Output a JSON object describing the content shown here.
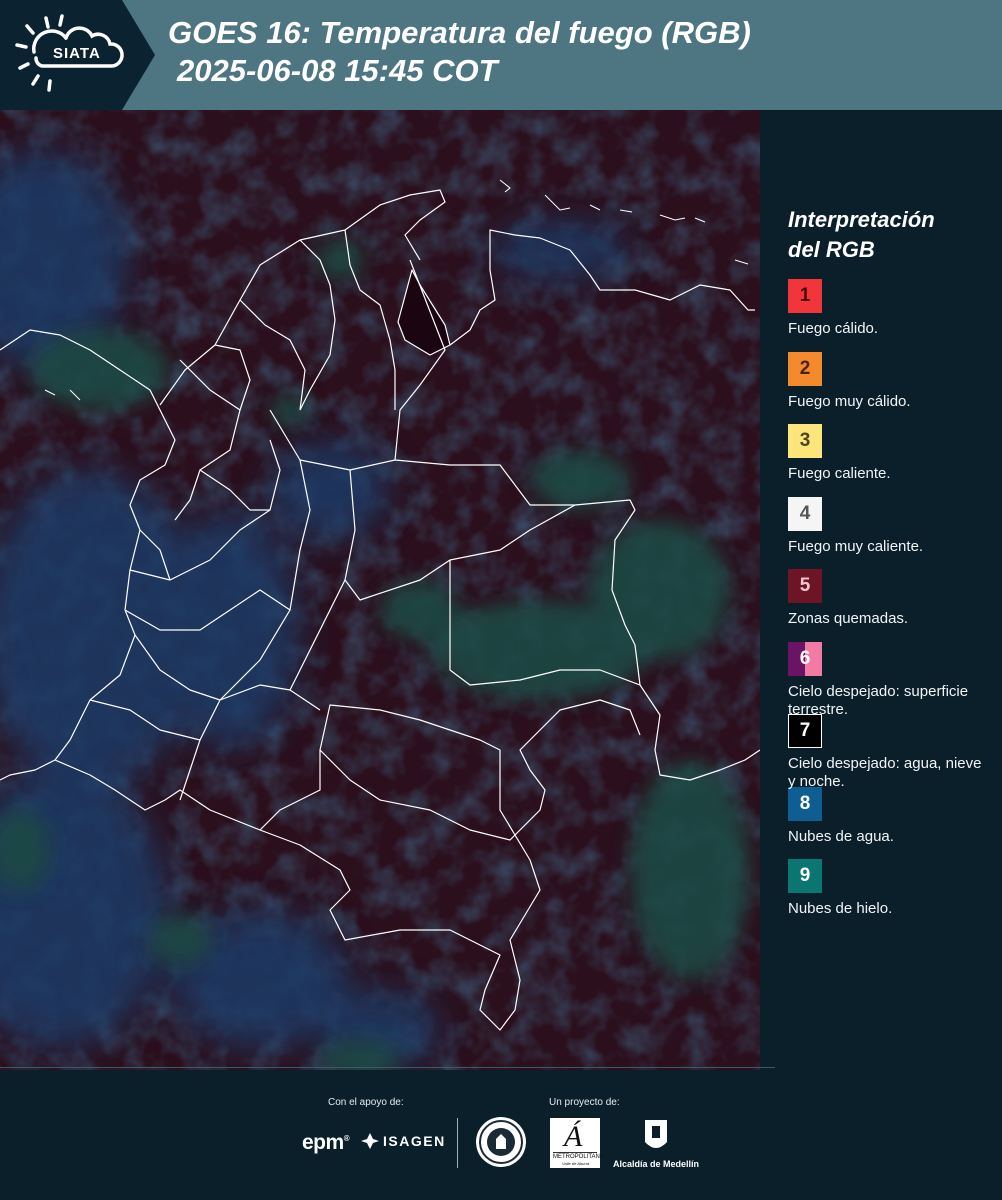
{
  "header": {
    "logo_text": "SIATA",
    "title_line1": "GOES 16: Temperatura del fuego (RGB)",
    "title_line2": "2025-06-08 15:45 COT"
  },
  "legend": {
    "title_line1": "Interpretación",
    "title_line2": "del RGB",
    "items": [
      {
        "num": "1",
        "label": "Fuego cálido.",
        "color": "#f1353a",
        "text_color": "#4a0a0a"
      },
      {
        "num": "2",
        "label": "Fuego muy cálido.",
        "color": "#f5892d",
        "text_color": "#4a2208"
      },
      {
        "num": "3",
        "label": "Fuego caliente.",
        "color": "#fce57a",
        "text_color": "#4d4420"
      },
      {
        "num": "4",
        "label": "Fuego muy caliente.",
        "color": "#f5f5f5",
        "text_color": "#555555"
      },
      {
        "num": "5",
        "label": "Zonas quemadas.",
        "color": "#6e1427",
        "text_color": "#f2c7cf"
      },
      {
        "num": "6",
        "label": "Cielo despejado: superficie terrestre.",
        "color": "#6a1466",
        "color2": "#f47aa6",
        "text_color": "#ffffff"
      },
      {
        "num": "7",
        "label": "Cielo despejado: agua, nieve y noche.",
        "color": "#000000",
        "text_color": "#ffffff"
      },
      {
        "num": "8",
        "label": "Nubes de agua.",
        "color": "#0f5e93",
        "text_color": "#ffffff"
      },
      {
        "num": "9",
        "label": "Nubes de hielo.",
        "color": "#0b7671",
        "text_color": "#ffffff"
      }
    ]
  },
  "footer": {
    "support_label": "Con el apoyo de:",
    "project_label": "Un proyecto de:",
    "epm_text": "epm",
    "isagen_text": "ISAGEN",
    "amva_text": "METROPOLITANA",
    "amva_sub": "Valle de Aburrá",
    "medellin_text": "Alcaldía de Medellín"
  },
  "colors": {
    "background": "#0b1f2b",
    "header": "#4e7582",
    "map_base": "#2b0f1c",
    "map_cloud_water": "#1f3a66",
    "map_cloud_ice": "#1e4a45",
    "borders": "#ffffff"
  }
}
